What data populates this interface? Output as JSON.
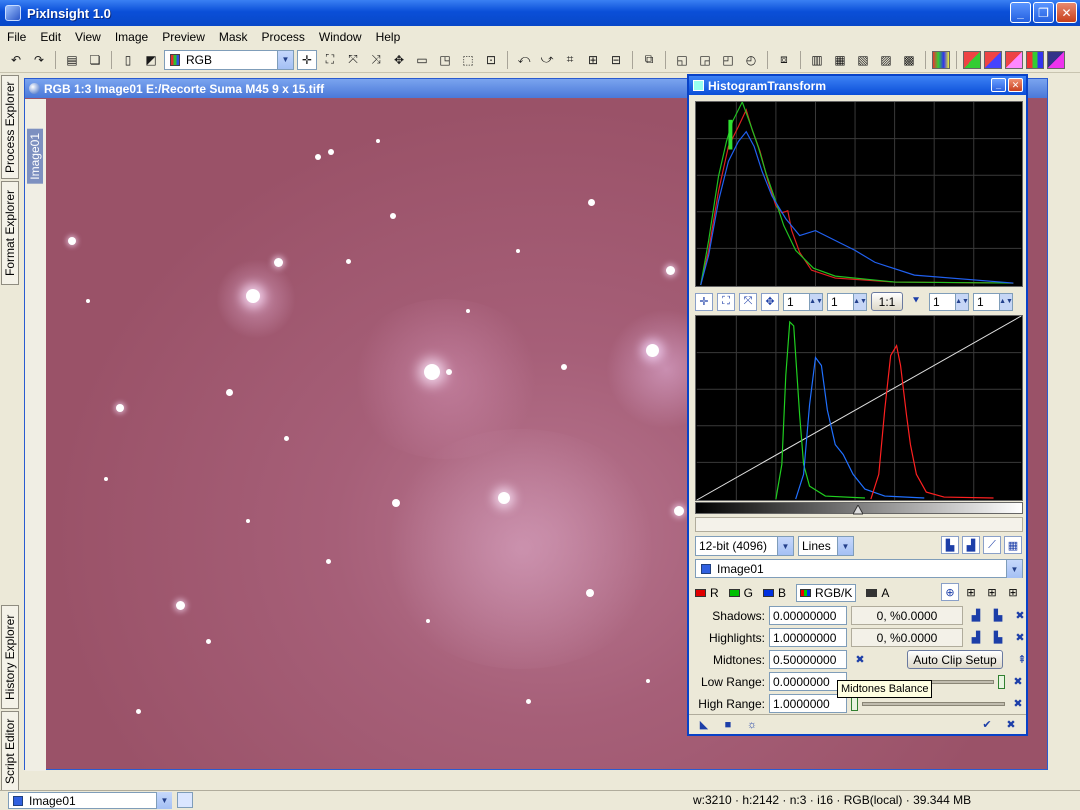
{
  "app": {
    "title": "PixInsight 1.0"
  },
  "menu": [
    "File",
    "Edit",
    "View",
    "Image",
    "Preview",
    "Mask",
    "Process",
    "Window",
    "Help"
  ],
  "toolbar": {
    "color_mode": "RGB"
  },
  "left_tabs": [
    "Process Explorer",
    "Format Explorer",
    "History Explorer",
    "Script Editor"
  ],
  "image_window": {
    "title": "RGB 1:3 Image01 E:/Recorte Suma M45 9 x 15.tiff",
    "side_label": "Image01"
  },
  "histogram": {
    "title": "HistogramTransform",
    "zoom_h_top": "1",
    "zoom_v_top": "1",
    "zoom_1to1": "1:1",
    "zoom_h_bottom": "1",
    "zoom_v_bottom": "1",
    "resolution": "12-bit (4096)",
    "graph_style": "Lines",
    "view": "Image01",
    "channels": [
      "R",
      "G",
      "B",
      "RGB/K",
      "A"
    ],
    "channel_colors": [
      "#e00000",
      "#00c000",
      "#0030e0",
      "#444444",
      "#333333"
    ],
    "shadows_label": "Shadows:",
    "shadows_value": "0.00000000",
    "shadows_clip": "0, %0.0000",
    "highlights_label": "Highlights:",
    "highlights_value": "1.00000000",
    "highlights_clip": "0, %0.0000",
    "midtones_label": "Midtones:",
    "midtones_value": "0.50000000",
    "auto_clip_label": "Auto Clip Setup",
    "low_range_label": "Low Range:",
    "low_range_value": "0.0000000",
    "high_range_label": "High Range:",
    "high_range_value": "1.0000000",
    "tooltip": "Midtones Balance"
  },
  "status": {
    "view": "Image01",
    "info": "w:3210 · h:2142 · n:3 · i16 · RGB(local) · 39.344 MB"
  }
}
